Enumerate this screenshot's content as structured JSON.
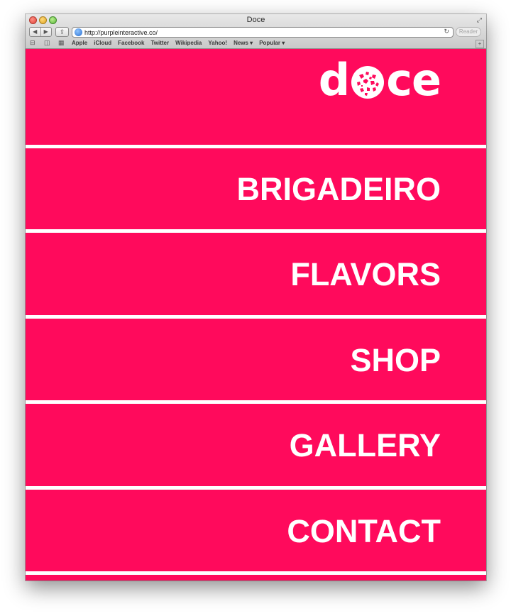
{
  "window": {
    "title": "Doce"
  },
  "toolbar": {
    "url": "http://purpleinteractive.co/",
    "reader_label": "Reader"
  },
  "bookmarks": [
    "Apple",
    "iCloud",
    "Facebook",
    "Twitter",
    "Wikipedia",
    "Yahoo!",
    "News ▾",
    "Popular ▾"
  ],
  "site": {
    "logo_text": "doce",
    "brand_color": "#ff0a5c",
    "nav": [
      "BRIGADEIRO",
      "FLAVORS",
      "SHOP",
      "GALLERY",
      "CONTACT"
    ]
  }
}
